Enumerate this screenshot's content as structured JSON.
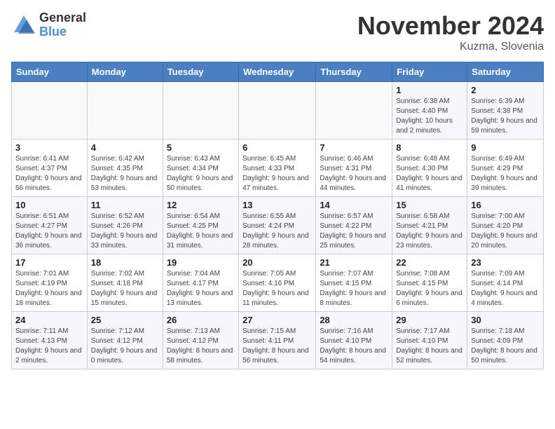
{
  "logo": {
    "line1": "General",
    "line2": "Blue"
  },
  "title": "November 2024",
  "location": "Kuzma, Slovenia",
  "weekdays": [
    "Sunday",
    "Monday",
    "Tuesday",
    "Wednesday",
    "Thursday",
    "Friday",
    "Saturday"
  ],
  "weeks": [
    [
      {
        "day": "",
        "info": ""
      },
      {
        "day": "",
        "info": ""
      },
      {
        "day": "",
        "info": ""
      },
      {
        "day": "",
        "info": ""
      },
      {
        "day": "",
        "info": ""
      },
      {
        "day": "1",
        "info": "Sunrise: 6:38 AM\nSunset: 4:40 PM\nDaylight: 10 hours and 2 minutes."
      },
      {
        "day": "2",
        "info": "Sunrise: 6:39 AM\nSunset: 4:38 PM\nDaylight: 9 hours and 59 minutes."
      }
    ],
    [
      {
        "day": "3",
        "info": "Sunrise: 6:41 AM\nSunset: 4:37 PM\nDaylight: 9 hours and 56 minutes."
      },
      {
        "day": "4",
        "info": "Sunrise: 6:42 AM\nSunset: 4:35 PM\nDaylight: 9 hours and 53 minutes."
      },
      {
        "day": "5",
        "info": "Sunrise: 6:43 AM\nSunset: 4:34 PM\nDaylight: 9 hours and 50 minutes."
      },
      {
        "day": "6",
        "info": "Sunrise: 6:45 AM\nSunset: 4:33 PM\nDaylight: 9 hours and 47 minutes."
      },
      {
        "day": "7",
        "info": "Sunrise: 6:46 AM\nSunset: 4:31 PM\nDaylight: 9 hours and 44 minutes."
      },
      {
        "day": "8",
        "info": "Sunrise: 6:48 AM\nSunset: 4:30 PM\nDaylight: 9 hours and 41 minutes."
      },
      {
        "day": "9",
        "info": "Sunrise: 6:49 AM\nSunset: 4:29 PM\nDaylight: 9 hours and 39 minutes."
      }
    ],
    [
      {
        "day": "10",
        "info": "Sunrise: 6:51 AM\nSunset: 4:27 PM\nDaylight: 9 hours and 36 minutes."
      },
      {
        "day": "11",
        "info": "Sunrise: 6:52 AM\nSunset: 4:26 PM\nDaylight: 9 hours and 33 minutes."
      },
      {
        "day": "12",
        "info": "Sunrise: 6:54 AM\nSunset: 4:25 PM\nDaylight: 9 hours and 31 minutes."
      },
      {
        "day": "13",
        "info": "Sunrise: 6:55 AM\nSunset: 4:24 PM\nDaylight: 9 hours and 28 minutes."
      },
      {
        "day": "14",
        "info": "Sunrise: 6:57 AM\nSunset: 4:22 PM\nDaylight: 9 hours and 25 minutes."
      },
      {
        "day": "15",
        "info": "Sunrise: 6:58 AM\nSunset: 4:21 PM\nDaylight: 9 hours and 23 minutes."
      },
      {
        "day": "16",
        "info": "Sunrise: 7:00 AM\nSunset: 4:20 PM\nDaylight: 9 hours and 20 minutes."
      }
    ],
    [
      {
        "day": "17",
        "info": "Sunrise: 7:01 AM\nSunset: 4:19 PM\nDaylight: 9 hours and 18 minutes."
      },
      {
        "day": "18",
        "info": "Sunrise: 7:02 AM\nSunset: 4:18 PM\nDaylight: 9 hours and 15 minutes."
      },
      {
        "day": "19",
        "info": "Sunrise: 7:04 AM\nSunset: 4:17 PM\nDaylight: 9 hours and 13 minutes."
      },
      {
        "day": "20",
        "info": "Sunrise: 7:05 AM\nSunset: 4:16 PM\nDaylight: 9 hours and 11 minutes."
      },
      {
        "day": "21",
        "info": "Sunrise: 7:07 AM\nSunset: 4:15 PM\nDaylight: 9 hours and 8 minutes."
      },
      {
        "day": "22",
        "info": "Sunrise: 7:08 AM\nSunset: 4:15 PM\nDaylight: 9 hours and 6 minutes."
      },
      {
        "day": "23",
        "info": "Sunrise: 7:09 AM\nSunset: 4:14 PM\nDaylight: 9 hours and 4 minutes."
      }
    ],
    [
      {
        "day": "24",
        "info": "Sunrise: 7:11 AM\nSunset: 4:13 PM\nDaylight: 9 hours and 2 minutes."
      },
      {
        "day": "25",
        "info": "Sunrise: 7:12 AM\nSunset: 4:12 PM\nDaylight: 9 hours and 0 minutes."
      },
      {
        "day": "26",
        "info": "Sunrise: 7:13 AM\nSunset: 4:12 PM\nDaylight: 8 hours and 58 minutes."
      },
      {
        "day": "27",
        "info": "Sunrise: 7:15 AM\nSunset: 4:11 PM\nDaylight: 8 hours and 56 minutes."
      },
      {
        "day": "28",
        "info": "Sunrise: 7:16 AM\nSunset: 4:10 PM\nDaylight: 8 hours and 54 minutes."
      },
      {
        "day": "29",
        "info": "Sunrise: 7:17 AM\nSunset: 4:10 PM\nDaylight: 8 hours and 52 minutes."
      },
      {
        "day": "30",
        "info": "Sunrise: 7:18 AM\nSunset: 4:09 PM\nDaylight: 8 hours and 50 minutes."
      }
    ]
  ]
}
